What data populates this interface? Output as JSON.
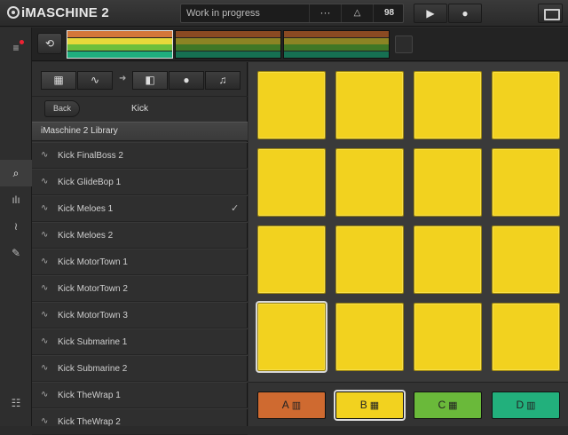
{
  "app": {
    "title": "iMASCHINE 2"
  },
  "project": {
    "name": "Work in progress",
    "more_label": "···",
    "metronome_icon": "metronome-icon",
    "tempo": "98"
  },
  "transport": {
    "play_icon": "play-icon",
    "record_icon": "record-icon"
  },
  "leftstrip": {
    "items": [
      {
        "icon": "menu-icon",
        "glyph": "≡"
      },
      {
        "icon": "search-icon",
        "glyph": "⌕"
      },
      {
        "icon": "mixer-icon",
        "glyph": "ılı"
      },
      {
        "icon": "waveform-icon",
        "glyph": "≀"
      },
      {
        "icon": "pencil-icon",
        "glyph": "✎"
      },
      {
        "icon": "sliders-icon",
        "glyph": "⧉"
      }
    ]
  },
  "arrangement": {
    "scenes": [
      {
        "selected": true,
        "colors": [
          "#d4773a",
          "#e6d93a",
          "#6bbf3c",
          "#1fae7e"
        ]
      },
      {
        "selected": false,
        "colors": [
          "#8a4a22",
          "#8c8424",
          "#3f7726",
          "#167052"
        ]
      },
      {
        "selected": false,
        "colors": [
          "#8a4a22",
          "#8c8424",
          "#3f7726",
          "#167052"
        ]
      }
    ]
  },
  "browser": {
    "filters": [
      {
        "icon": "grid-icon",
        "glyph": "▦"
      },
      {
        "icon": "waveform-filter-icon",
        "glyph": "∿"
      },
      {
        "icon": "instrument-icon",
        "glyph": "◧"
      },
      {
        "icon": "user-icon",
        "glyph": "●"
      },
      {
        "icon": "note-icon",
        "glyph": "♫"
      }
    ],
    "back_label": "Back",
    "nav_title": "Kick",
    "library_header": "iMaschine 2 Library",
    "items": [
      {
        "name": "Kick FinalBoss 2",
        "checked": false
      },
      {
        "name": "Kick GlideBop 1",
        "checked": false
      },
      {
        "name": "Kick Meloes 1",
        "checked": true
      },
      {
        "name": "Kick Meloes 2",
        "checked": false
      },
      {
        "name": "Kick MotorTown 1",
        "checked": false
      },
      {
        "name": "Kick MotorTown 2",
        "checked": false
      },
      {
        "name": "Kick MotorTown 3",
        "checked": false
      },
      {
        "name": "Kick Submarine 1",
        "checked": false
      },
      {
        "name": "Kick Submarine 2",
        "checked": false
      },
      {
        "name": "Kick TheWrap 1",
        "checked": false
      },
      {
        "name": "Kick TheWrap 2",
        "checked": false
      }
    ],
    "check_glyph": "✓"
  },
  "pads": {
    "count": 16,
    "selected_index": 12,
    "color": "#f2d21f"
  },
  "groups": [
    {
      "label": "A",
      "color": "#cf6a30",
      "selected": false,
      "icon": "keyboard-icon",
      "glyph": "▥"
    },
    {
      "label": "B",
      "color": "#f2d21f",
      "selected": true,
      "icon": "pad-grid-icon",
      "glyph": "▦"
    },
    {
      "label": "C",
      "color": "#6ab93a",
      "selected": false,
      "icon": "pad-grid-icon",
      "glyph": "▦"
    },
    {
      "label": "D",
      "color": "#22b07c",
      "selected": false,
      "icon": "keyboard-icon",
      "glyph": "▥"
    }
  ]
}
